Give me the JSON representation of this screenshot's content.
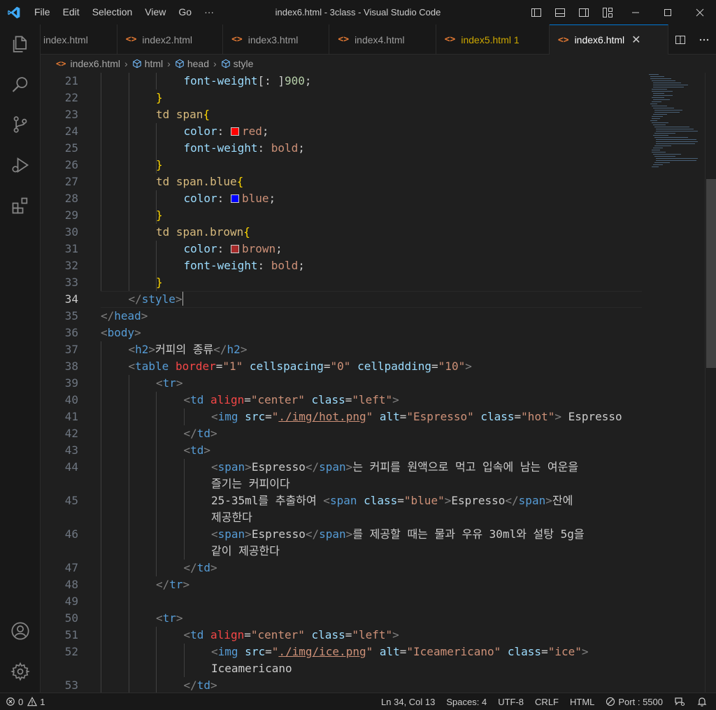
{
  "titlebar": {
    "menu": [
      "File",
      "Edit",
      "Selection",
      "View",
      "Go",
      "···"
    ],
    "title": "index6.html - 3class - Visual Studio Code"
  },
  "tabs": [
    {
      "label": "index.html",
      "state": "normal",
      "icon": false
    },
    {
      "label": "index2.html",
      "state": "normal",
      "icon": true
    },
    {
      "label": "index3.html",
      "state": "normal",
      "icon": true
    },
    {
      "label": "index4.html",
      "state": "normal",
      "icon": true
    },
    {
      "label": "index5.html 1",
      "state": "warning",
      "icon": true
    },
    {
      "label": "index6.html",
      "state": "active",
      "icon": true
    }
  ],
  "breadcrumb": {
    "file": "index6.html",
    "items": [
      "html",
      "head",
      "style"
    ]
  },
  "editor": {
    "current_line": 34,
    "lines": [
      {
        "n": "21",
        "indent": 3,
        "tokens": [
          [
            "t-prop",
            "font-weight"
          ],
          [
            "",
            "[: ]"
          ],
          [
            "t-num",
            "900"
          ],
          [
            "",
            ";"
          ]
        ]
      },
      {
        "n": "22",
        "indent": 2,
        "tokens": [
          [
            "t-brace",
            "}"
          ]
        ]
      },
      {
        "n": "23",
        "indent": 2,
        "tokens": [
          [
            "t-sel",
            "td span"
          ],
          [
            "t-brace",
            "{"
          ]
        ]
      },
      {
        "n": "24",
        "indent": 3,
        "tokens": [
          [
            "t-prop",
            "color"
          ],
          [
            "",
            ": "
          ],
          [
            "swatch",
            "#ff0000"
          ],
          [
            "t-val",
            "red"
          ],
          [
            "",
            ";"
          ]
        ]
      },
      {
        "n": "25",
        "indent": 3,
        "tokens": [
          [
            "t-prop",
            "font-weight"
          ],
          [
            "",
            ": "
          ],
          [
            "t-val",
            "bold"
          ],
          [
            "",
            ";"
          ]
        ]
      },
      {
        "n": "26",
        "indent": 2,
        "tokens": [
          [
            "t-brace",
            "}"
          ]
        ]
      },
      {
        "n": "27",
        "indent": 2,
        "tokens": [
          [
            "t-sel",
            "td span.blue"
          ],
          [
            "t-brace",
            "{"
          ]
        ]
      },
      {
        "n": "28",
        "indent": 3,
        "tokens": [
          [
            "t-prop",
            "color"
          ],
          [
            "",
            ": "
          ],
          [
            "swatch",
            "#0000ff"
          ],
          [
            "t-val",
            "blue"
          ],
          [
            "",
            ";"
          ]
        ]
      },
      {
        "n": "29",
        "indent": 2,
        "tokens": [
          [
            "t-brace",
            "}"
          ]
        ]
      },
      {
        "n": "30",
        "indent": 2,
        "tokens": [
          [
            "t-sel",
            "td span.brown"
          ],
          [
            "t-brace",
            "{"
          ]
        ]
      },
      {
        "n": "31",
        "indent": 3,
        "tokens": [
          [
            "t-prop",
            "color"
          ],
          [
            "",
            ": "
          ],
          [
            "swatch",
            "#a52a2a"
          ],
          [
            "t-val",
            "brown"
          ],
          [
            "",
            ";"
          ]
        ]
      },
      {
        "n": "32",
        "indent": 3,
        "tokens": [
          [
            "t-prop",
            "font-weight"
          ],
          [
            "",
            ": "
          ],
          [
            "t-val",
            "bold"
          ],
          [
            "",
            ";"
          ]
        ]
      },
      {
        "n": "33",
        "indent": 2,
        "tokens": [
          [
            "t-brace",
            "}"
          ]
        ]
      },
      {
        "n": "34",
        "indent": 1,
        "tokens": [
          [
            "t-br",
            "</"
          ],
          [
            "t-tag",
            "style"
          ],
          [
            "t-br",
            ">"
          ]
        ]
      },
      {
        "n": "35",
        "indent": 0,
        "tokens": [
          [
            "t-br",
            "</"
          ],
          [
            "t-tag",
            "head"
          ],
          [
            "t-br",
            ">"
          ]
        ]
      },
      {
        "n": "36",
        "indent": 0,
        "tokens": [
          [
            "t-br",
            "<"
          ],
          [
            "t-tag",
            "body"
          ],
          [
            "t-br",
            ">"
          ]
        ]
      },
      {
        "n": "37",
        "indent": 1,
        "tokens": [
          [
            "t-br",
            "<"
          ],
          [
            "t-tag",
            "h2"
          ],
          [
            "t-br",
            ">"
          ],
          [
            "",
            "커피의 종류"
          ],
          [
            "t-br",
            "</"
          ],
          [
            "t-tag",
            "h2"
          ],
          [
            "t-br",
            ">"
          ]
        ]
      },
      {
        "n": "38",
        "indent": 1,
        "tokens": [
          [
            "t-br",
            "<"
          ],
          [
            "t-tag",
            "table"
          ],
          [
            "",
            ""
          ],
          [
            "t-attr-red",
            " border"
          ],
          [
            "",
            "="
          ],
          [
            "t-str",
            "\"1\""
          ],
          [
            "t-attr",
            " cellspacing"
          ],
          [
            "",
            "="
          ],
          [
            "t-str",
            "\"0\""
          ],
          [
            "t-attr",
            " cellpadding"
          ],
          [
            "",
            "="
          ],
          [
            "t-str",
            "\"10\""
          ],
          [
            "t-br",
            ">"
          ]
        ]
      },
      {
        "n": "39",
        "indent": 2,
        "tokens": [
          [
            "t-br",
            "<"
          ],
          [
            "t-tag",
            "tr"
          ],
          [
            "t-br",
            ">"
          ]
        ]
      },
      {
        "n": "40",
        "indent": 3,
        "tokens": [
          [
            "t-br",
            "<"
          ],
          [
            "t-tag",
            "td"
          ],
          [
            "t-attr-red",
            " align"
          ],
          [
            "",
            "="
          ],
          [
            "t-str",
            "\"center\""
          ],
          [
            "t-attr",
            " class"
          ],
          [
            "",
            "="
          ],
          [
            "t-str",
            "\"left\""
          ],
          [
            "t-br",
            ">"
          ]
        ]
      },
      {
        "n": "41",
        "indent": 4,
        "tokens": [
          [
            "t-br",
            "<"
          ],
          [
            "t-tag",
            "img"
          ],
          [
            "t-attr",
            " src"
          ],
          [
            "",
            "="
          ],
          [
            "t-str",
            "\""
          ],
          [
            "t-link",
            "./img/hot.png"
          ],
          [
            "t-str",
            "\""
          ],
          [
            "t-attr",
            " alt"
          ],
          [
            "",
            "="
          ],
          [
            "t-str",
            "\"Espresso\""
          ],
          [
            "t-attr",
            " class"
          ],
          [
            "",
            "="
          ],
          [
            "t-str",
            "\"hot\""
          ],
          [
            "t-br",
            ">"
          ],
          [
            "",
            " Espresso"
          ]
        ]
      },
      {
        "n": "42",
        "indent": 3,
        "tokens": [
          [
            "t-br",
            "</"
          ],
          [
            "t-tag",
            "td"
          ],
          [
            "t-br",
            ">"
          ]
        ]
      },
      {
        "n": "43",
        "indent": 3,
        "tokens": [
          [
            "t-br",
            "<"
          ],
          [
            "t-tag",
            "td"
          ],
          [
            "t-br",
            ">"
          ]
        ]
      },
      {
        "n": "44",
        "indent": 4,
        "tokens": [
          [
            "t-br",
            "<"
          ],
          [
            "t-tag",
            "span"
          ],
          [
            "t-br",
            ">"
          ],
          [
            "",
            "Espresso"
          ],
          [
            "t-br",
            "</"
          ],
          [
            "t-tag",
            "span"
          ],
          [
            "t-br",
            ">"
          ],
          [
            "",
            "는 커피를 원액으로 먹고 입속에 남는 여운을"
          ]
        ],
        "wrap": "즐기는 커피이다"
      },
      {
        "n": "45",
        "indent": 4,
        "tokens": [
          [
            "",
            "25-35ml를 추출하여 "
          ],
          [
            "t-br",
            "<"
          ],
          [
            "t-tag",
            "span"
          ],
          [
            "t-attr",
            " class"
          ],
          [
            "",
            "="
          ],
          [
            "t-str",
            "\"blue\""
          ],
          [
            "t-br",
            ">"
          ],
          [
            "",
            "Espresso"
          ],
          [
            "t-br",
            "</"
          ],
          [
            "t-tag",
            "span"
          ],
          [
            "t-br",
            ">"
          ],
          [
            "",
            "잔에"
          ]
        ],
        "wrap": "제공한다"
      },
      {
        "n": "46",
        "indent": 4,
        "tokens": [
          [
            "t-br",
            "<"
          ],
          [
            "t-tag",
            "span"
          ],
          [
            "t-br",
            ">"
          ],
          [
            "",
            "Espresso"
          ],
          [
            "t-br",
            "</"
          ],
          [
            "t-tag",
            "span"
          ],
          [
            "t-br",
            ">"
          ],
          [
            "",
            "를 제공할 때는 물과 우유 30ml와 설탕 5g을"
          ]
        ],
        "wrap": "같이 제공한다"
      },
      {
        "n": "47",
        "indent": 3,
        "tokens": [
          [
            "t-br",
            "</"
          ],
          [
            "t-tag",
            "td"
          ],
          [
            "t-br",
            ">"
          ]
        ]
      },
      {
        "n": "48",
        "indent": 2,
        "tokens": [
          [
            "t-br",
            "</"
          ],
          [
            "t-tag",
            "tr"
          ],
          [
            "t-br",
            ">"
          ]
        ]
      },
      {
        "n": "49",
        "indent": 0,
        "tokens": []
      },
      {
        "n": "50",
        "indent": 2,
        "tokens": [
          [
            "t-br",
            "<"
          ],
          [
            "t-tag",
            "tr"
          ],
          [
            "t-br",
            ">"
          ]
        ]
      },
      {
        "n": "51",
        "indent": 3,
        "tokens": [
          [
            "t-br",
            "<"
          ],
          [
            "t-tag",
            "td"
          ],
          [
            "t-attr-red",
            " align"
          ],
          [
            "",
            "="
          ],
          [
            "t-str",
            "\"center\""
          ],
          [
            "t-attr",
            " class"
          ],
          [
            "",
            "="
          ],
          [
            "t-str",
            "\"left\""
          ],
          [
            "t-br",
            ">"
          ]
        ]
      },
      {
        "n": "52",
        "indent": 4,
        "tokens": [
          [
            "t-br",
            "<"
          ],
          [
            "t-tag",
            "img"
          ],
          [
            "t-attr",
            " src"
          ],
          [
            "",
            "="
          ],
          [
            "t-str",
            "\""
          ],
          [
            "t-link",
            "./img/ice.png"
          ],
          [
            "t-str",
            "\""
          ],
          [
            "t-attr",
            " alt"
          ],
          [
            "",
            "="
          ],
          [
            "t-str",
            "\"Iceamericano\""
          ],
          [
            "t-attr",
            " class"
          ],
          [
            "",
            "="
          ],
          [
            "t-str",
            "\"ice\""
          ],
          [
            "t-br",
            ">"
          ]
        ],
        "wrap": "Iceamericano"
      },
      {
        "n": "53",
        "indent": 3,
        "tokens": [
          [
            "t-br",
            "</"
          ],
          [
            "t-tag",
            "td"
          ],
          [
            "t-br",
            ">"
          ]
        ]
      }
    ]
  },
  "status": {
    "errors": "0",
    "warnings": "1",
    "position": "Ln 34, Col 13",
    "spaces": "Spaces: 4",
    "encoding": "UTF-8",
    "eol": "CRLF",
    "language": "HTML",
    "port": "Port : 5500"
  }
}
